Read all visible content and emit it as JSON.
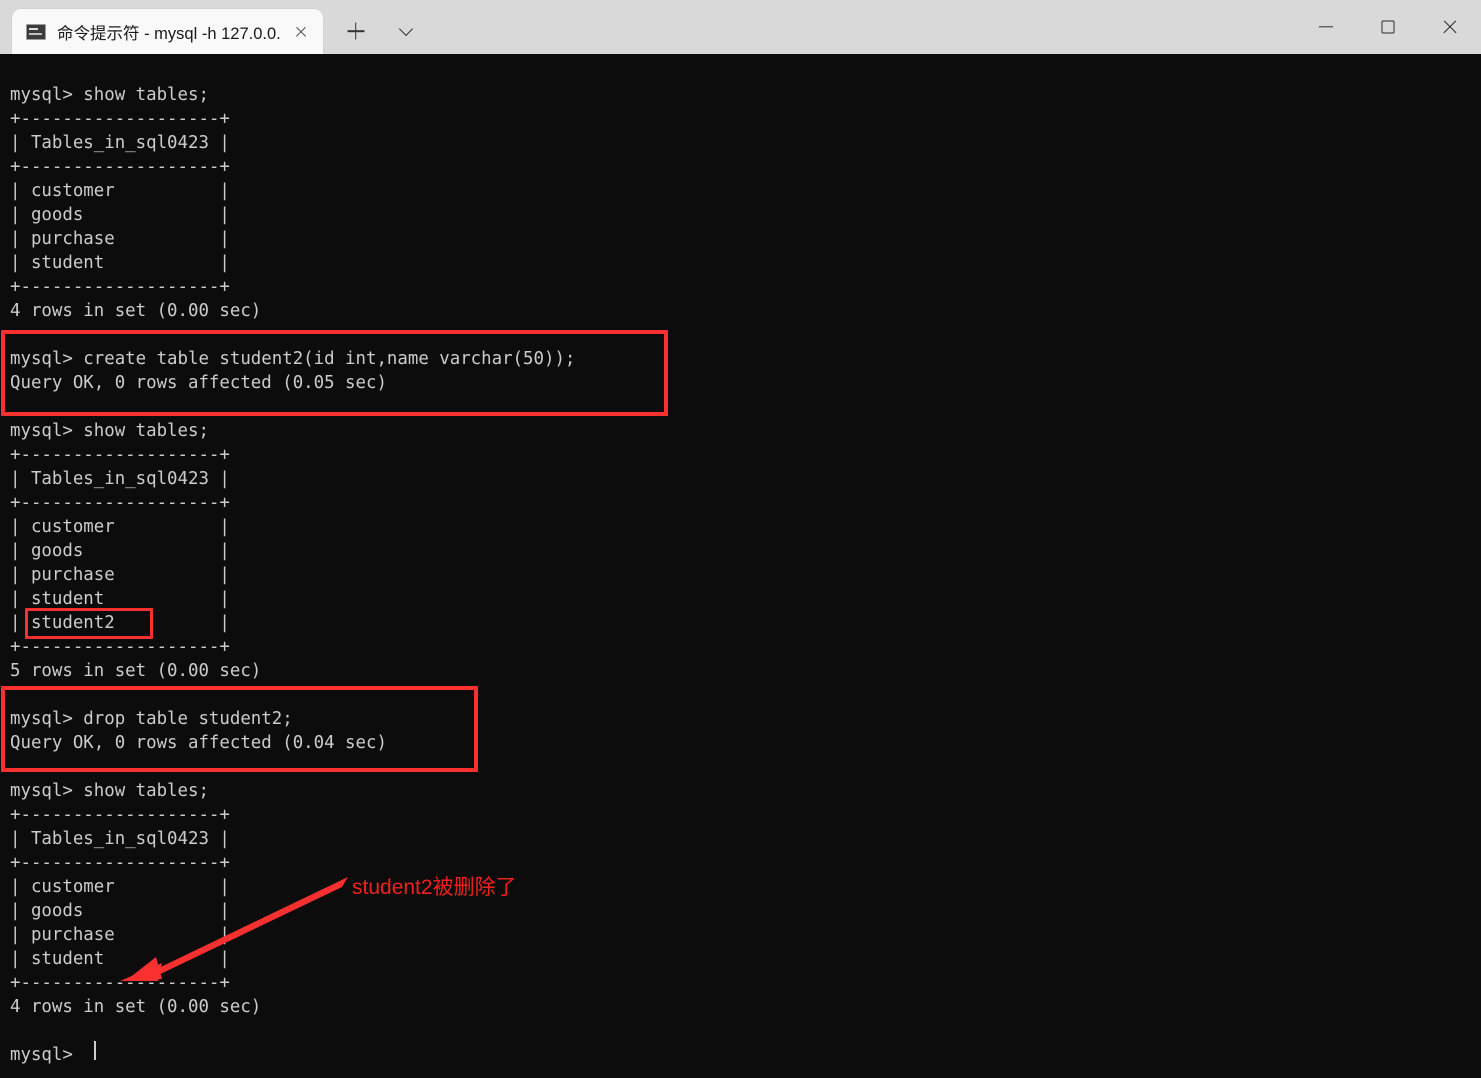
{
  "window": {
    "tab": {
      "icon": "console-icon",
      "title": "命令提示符 - mysql  -h 127.0.0.",
      "close_label": "close-tab"
    },
    "new_tab_label": "+",
    "dropdown_label": "v",
    "controls": {
      "minimize": "minimize",
      "maximize": "maximize",
      "close": "close"
    }
  },
  "terminal": {
    "background_color": "#0c0c0c",
    "foreground_color": "#cccccc",
    "content": "mysql> show tables;\n+-------------------+\n| Tables_in_sql0423 |\n+-------------------+\n| customer          |\n| goods             |\n| purchase          |\n| student           |\n+-------------------+\n4 rows in set (0.00 sec)\n\nmysql> create table student2(id int,name varchar(50));\nQuery OK, 0 rows affected (0.05 sec)\n\nmysql> show tables;\n+-------------------+\n| Tables_in_sql0423 |\n+-------------------+\n| customer          |\n| goods             |\n| purchase          |\n| student           |\n| student2          |\n+-------------------+\n5 rows in set (0.00 sec)\n\nmysql> drop table student2;\nQuery OK, 0 rows affected (0.04 sec)\n\nmysql> show tables;\n+-------------------+\n| Tables_in_sql0423 |\n+-------------------+\n| customer          |\n| goods             |\n| purchase          |\n| student           |\n+-------------------+\n4 rows in set (0.00 sec)\n\nmysql> ",
    "prompt": "mysql> ",
    "cursor": "block-caret"
  },
  "annotations": {
    "color": "#f93030",
    "note_text": "student2被删除了",
    "highlight_create": "create table student2(id int,name varchar(50)); / Query OK, 0 rows affected (0.05 sec)",
    "highlight_student2_row": "student2",
    "highlight_drop": "drop table student2; / Query OK, 0 rows affected (0.04 sec)",
    "arrow": "arrow pointing to table listing without student2"
  }
}
